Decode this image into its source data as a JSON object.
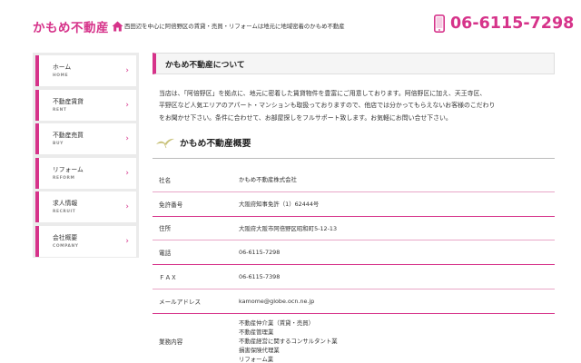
{
  "header": {
    "logo": "かもめ不動産",
    "tagline": "西田辺を中心に阿倍野区の賃貸・売買・リフォームは地元に地域密着のかもめ不動産",
    "phone": "06-6115-7298"
  },
  "sidebar": {
    "items": [
      {
        "label": "ホーム",
        "sub": "HOME"
      },
      {
        "label": "不動産賃貸",
        "sub": "RENT"
      },
      {
        "label": "不動産売買",
        "sub": "BUY"
      },
      {
        "label": "リフォーム",
        "sub": "REFORM"
      },
      {
        "label": "求人情報",
        "sub": "RECRUIT"
      },
      {
        "label": "会社概要",
        "sub": "COMPANY"
      }
    ]
  },
  "main": {
    "section_title": "かもめ不動産について",
    "intro_lines": [
      "当店は、「阿倍野区」を拠点に、地元に密着した賃貸物件を豊富にご用意しております。阿倍野区に加え、天王寺区、",
      "平野区など人気エリアのアパート・マンションも取扱っておりますので、他店では分かってもらえないお客様のこだわり",
      "をお聞かせ下さい。条件に合わせて、お部屋探しをフルサポート致します。お気軽にお問い合せ下さい。"
    ],
    "overview_title": "かもめ不動産概要",
    "rows": [
      {
        "label": "社名",
        "value": "かもめ不動産株式会社"
      },
      {
        "label": "免許番号",
        "value": "大阪府知事免許（1）62444号"
      },
      {
        "label": "住所",
        "value": "大阪府大阪市阿倍野区昭和町5-12-13"
      },
      {
        "label": "電話",
        "value": "06-6115-7298"
      },
      {
        "label": "ＦＡＸ",
        "value": "06-6115-7398"
      },
      {
        "label": "メールアドレス",
        "value": "kamome@globe.ocn.ne.jp"
      }
    ],
    "business": {
      "label": "業務内容",
      "lines": [
        "不動産仲介業（賃貸・売買）",
        "不動産管理業",
        "不動産経営に関するコンサルタント業",
        "損害保険代理業",
        "リフォーム業"
      ]
    }
  },
  "colors": {
    "accent": "#d6338a",
    "sidebar_bg": "#ebebeb",
    "title_bg": "#f5f5f5"
  },
  "icons": {
    "logo": "house-icon",
    "phone": "smartphone-icon",
    "overview": "bird-icon",
    "nav": "chevron-right-icon"
  }
}
